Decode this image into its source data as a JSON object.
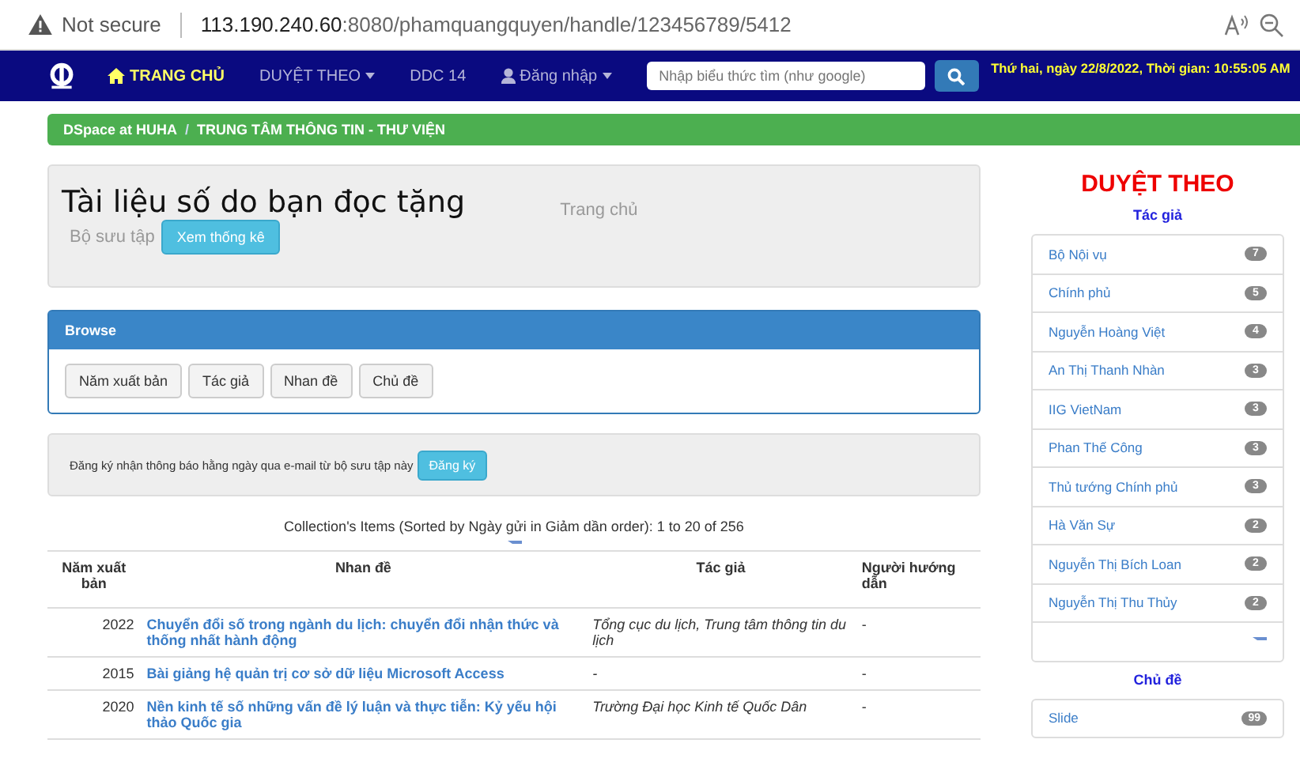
{
  "browser": {
    "security": "Not secure",
    "url_host": "113.190.240.60",
    "url_path": ":8080/phamquangquyen/handle/123456789/5412"
  },
  "nav": {
    "items": [
      {
        "label": "TRANG CHỦ",
        "kind": "home",
        "selected": true
      },
      {
        "label": "DUYỆT THEO",
        "kind": "dropdown",
        "selected": false
      },
      {
        "label": "DDC 14",
        "kind": "plain",
        "selected": false
      },
      {
        "label": "Đăng nhập",
        "kind": "user",
        "selected": false
      }
    ],
    "search": {
      "placeholder": "Nhập biểu thức tìm (như google)"
    },
    "datetime": "Thứ hai, ngày 22/8/2022, Thời gian: 10:55:05 AM"
  },
  "breadcrumb": {
    "separator": "/",
    "items": [
      "DSpace at HUHA",
      "TRUNG TÂM THÔNG TIN - THƯ VIỆN"
    ]
  },
  "header": {
    "title": "Tài liệu số do bạn đọc tặng",
    "home_link": "Trang chủ",
    "collection_label": "Bộ sưu tập",
    "stats_button": "Xem thống kê"
  },
  "browse": {
    "title": "Browse",
    "buttons": [
      "Năm xuất bản",
      "Tác giả",
      "Nhan đề",
      "Chủ đề"
    ]
  },
  "subscribe": {
    "text": "Đăng ký nhận thông báo hằng ngày qua e-mail từ bộ sưu tập này",
    "button": "Đăng ký"
  },
  "table": {
    "caption": "Collection's Items (Sorted by Ngày gửi in Giảm dần order): 1 to 20 of 256",
    "columns": [
      "Năm xuất bản",
      "Nhan đề",
      "Tác giả",
      "Người hướng dẫn"
    ],
    "rows": [
      {
        "year": "2022",
        "title": "Chuyển đổi số trong ngành du lịch: chuyển đổi nhận thức và thống nhất hành động",
        "author": "Tổng cục du lịch, Trung tâm thông tin du lịch",
        "advisor": "-"
      },
      {
        "year": "2015",
        "title": "Bài giảng hệ quản trị cơ sở dữ liệu Microsoft Access",
        "author": "-",
        "advisor": "-"
      },
      {
        "year": "2020",
        "title": "Nền kinh tế số những vấn đề lý luận và thực tiễn: Kỷ yếu hội thảo Quốc gia",
        "author": "Trường Đại học Kinh tế Quốc Dân",
        "advisor": "-"
      }
    ]
  },
  "sidebar": {
    "title": "DUYỆT THEO",
    "sections": [
      {
        "heading": "Tác giả",
        "items": [
          {
            "label": "Bộ Nội vụ",
            "count": "7"
          },
          {
            "label": "Chính phủ",
            "count": "5"
          },
          {
            "label": "Nguyễn Hoàng Việt",
            "count": "4"
          },
          {
            "label": "An Thị Thanh Nhàn",
            "count": "3"
          },
          {
            "label": "IIG VietNam",
            "count": "3"
          },
          {
            "label": "Phan Thế Công",
            "count": "3"
          },
          {
            "label": "Thủ tướng Chính phủ",
            "count": "3"
          },
          {
            "label": "Hà Văn Sự",
            "count": "2"
          },
          {
            "label": "Nguyễn Thị Bích Loan",
            "count": "2"
          },
          {
            "label": "Nguyễn Thị Thu Thủy",
            "count": "2"
          }
        ],
        "more": true
      },
      {
        "heading": "Chủ đề",
        "items": [
          {
            "label": "Slide",
            "count": "99"
          }
        ],
        "more": false
      }
    ]
  }
}
